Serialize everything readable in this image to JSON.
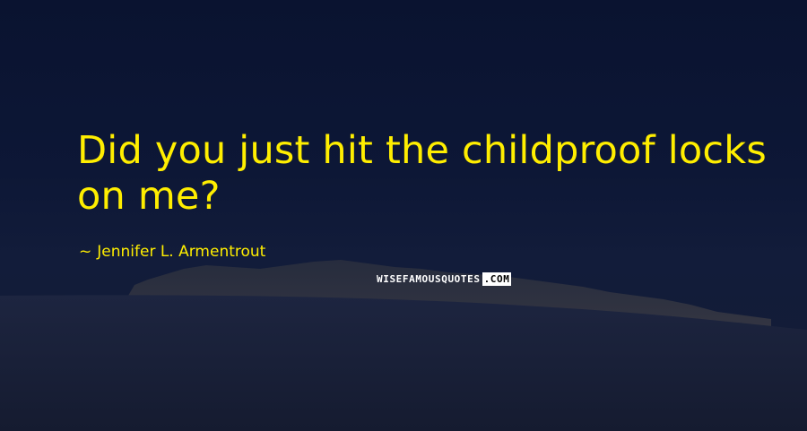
{
  "quote": {
    "text": "Did you just hit the childproof locks on me?"
  },
  "attribution": {
    "dash": "~",
    "author": "Jennifer L. Armentrout"
  },
  "watermark": {
    "main": "WISEFAMOUSQUOTES",
    "tld": ".COM"
  },
  "colors": {
    "quote_text": "#ffee00",
    "sky": "#0b1430",
    "snow": "#1a2238"
  }
}
